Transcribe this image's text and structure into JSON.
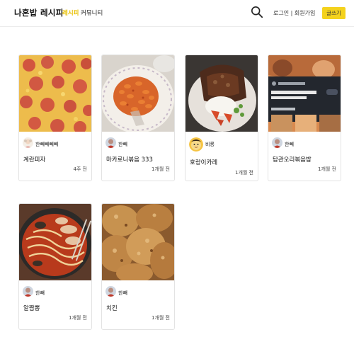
{
  "header": {
    "logo": "나혼밥 레시피",
    "nav": [
      {
        "label": "레시피",
        "active": true
      },
      {
        "label": "커뮤니티",
        "active": false
      }
    ],
    "search_icon": "search-icon",
    "login": "로그인",
    "separator": " | ",
    "signup": "회원가입",
    "write_button": "글쓰기"
  },
  "colors": {
    "accent": "#f4d21d",
    "active_nav": "#e8c000"
  },
  "recipes": [
    {
      "title": "계란피자",
      "author": "한빼빼빼빼",
      "time": "4주 전"
    },
    {
      "title": "마카로니볶음 333",
      "author": "한빼",
      "time": "1개월 전"
    },
    {
      "title": "호랑이카레",
      "author": "비룡",
      "time": "1개월 전"
    },
    {
      "title": "탐관오리볶음밥",
      "author": "한빼",
      "time": "1개월 전"
    },
    {
      "title": "알짬뽕",
      "author": "한빼",
      "time": "1개월 전"
    },
    {
      "title": "치킨",
      "author": "한빼",
      "time": "1개월 전"
    }
  ]
}
